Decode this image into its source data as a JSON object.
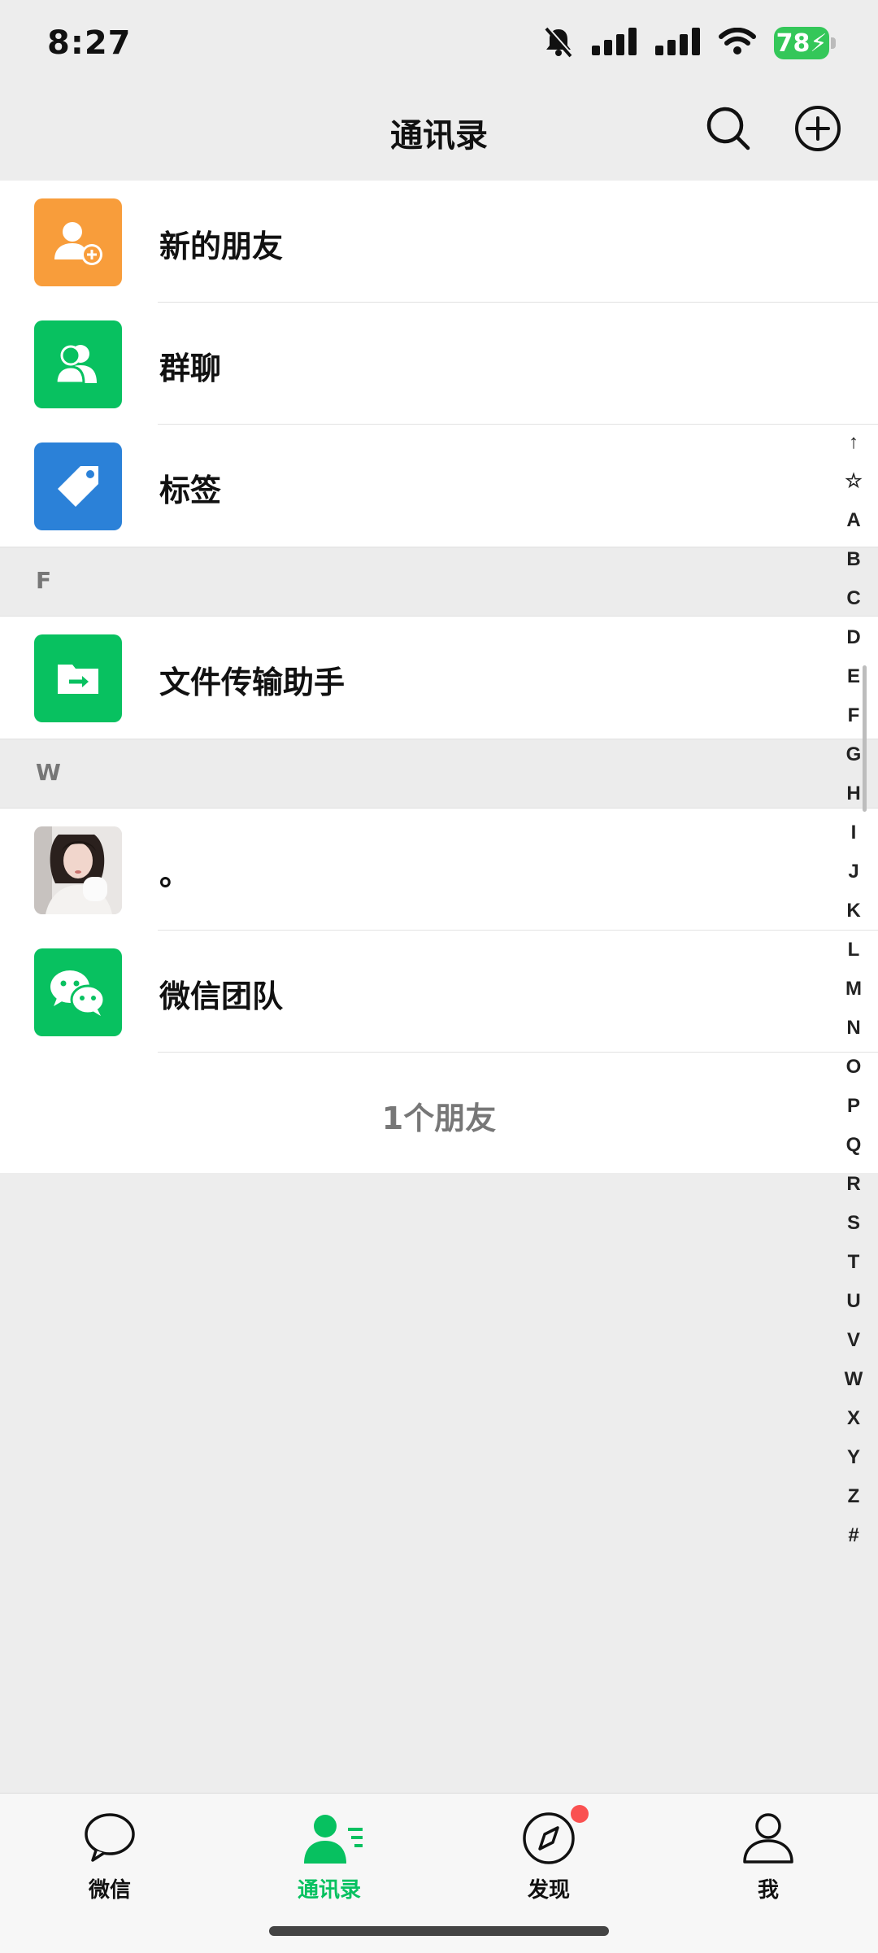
{
  "status_bar": {
    "time": "8:27",
    "battery": "78"
  },
  "header": {
    "title": "通讯录"
  },
  "menu": [
    {
      "label": "新的朋友",
      "color": "#f89d3b",
      "icon": "new-friend-icon"
    },
    {
      "label": "群聊",
      "color": "#08c160",
      "icon": "group-chat-icon"
    },
    {
      "label": "标签",
      "color": "#2b81d8",
      "icon": "tag-icon"
    }
  ],
  "sections": [
    {
      "letter": "F",
      "contacts": [
        {
          "name": "文件传输助手",
          "color": "#08c160",
          "icon": "file-transfer-icon"
        }
      ]
    },
    {
      "letter": "W",
      "contacts": [
        {
          "name": "。",
          "icon": "avatar-photo"
        },
        {
          "name": "微信团队",
          "color": "#08c160",
          "icon": "wechat-icon"
        }
      ]
    }
  ],
  "friend_count": "1个朋友",
  "index_letters": [
    "↑",
    "☆",
    "A",
    "B",
    "C",
    "D",
    "E",
    "F",
    "G",
    "H",
    "I",
    "J",
    "K",
    "L",
    "M",
    "N",
    "O",
    "P",
    "Q",
    "R",
    "S",
    "T",
    "U",
    "V",
    "W",
    "X",
    "Y",
    "Z",
    "#"
  ],
  "tabs": [
    {
      "label": "微信",
      "icon": "chat-bubble-icon",
      "active": false
    },
    {
      "label": "通讯录",
      "icon": "contacts-icon",
      "active": true
    },
    {
      "label": "发现",
      "icon": "compass-icon",
      "active": false
    },
    {
      "label": "我",
      "icon": "me-icon",
      "active": false
    }
  ],
  "colors": {
    "accent": "#07c160",
    "badge": "#fa5151",
    "background": "#ededed"
  }
}
